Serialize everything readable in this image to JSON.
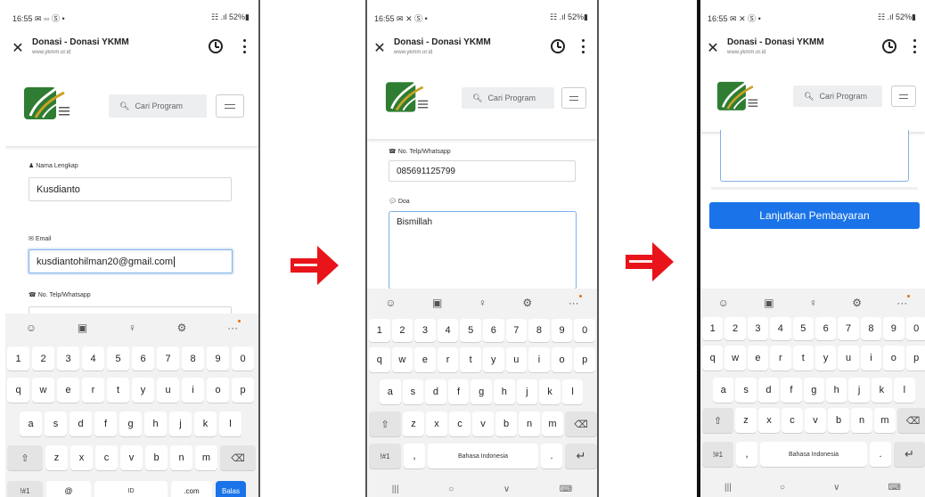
{
  "browser": {
    "title": "Donasi - Donasi YKMM",
    "url": "www.ykmm.or.id"
  },
  "site": {
    "search_label": "Cari Program"
  },
  "screens": [
    {
      "status_time": "16:55",
      "status_icons_left": "✉ ▫▫ Ⓢ •",
      "status_icons_right": "☷ .ıl 52%▮",
      "form": {
        "name_label": "Nama Lengkap",
        "name_value": "Kusdianto",
        "email_label": "Email",
        "email_value": "kusdiantohilman20@gmail.com",
        "phone_label": "No. Telp/Whatsapp"
      },
      "keyboard": {
        "bottom_keys": [
          "!#1",
          "@",
          "ID",
          ".com",
          "Balas"
        ]
      }
    },
    {
      "status_time": "16:55",
      "status_icons_left": "✉ ✕ Ⓢ •",
      "status_icons_right": "☷ .ıl 52%▮",
      "form": {
        "phone_label": "No. Telp/Whatsapp",
        "phone_value": "085691125799",
        "doa_label": "Doa",
        "doa_value": "Bismillah"
      }
    },
    {
      "status_time": "16:55",
      "status_icons_left": "✉ ✕ Ⓢ •",
      "status_icons_right": "☷ .ıl 52%▮",
      "form": {
        "submit_label": "Lanjutkan Pembayaran"
      }
    }
  ],
  "keyboard": {
    "toolbar_icons": [
      "☺",
      "▣",
      "♀",
      "⚙",
      "···"
    ],
    "numbers": [
      "1",
      "2",
      "3",
      "4",
      "5",
      "6",
      "7",
      "8",
      "9",
      "0"
    ],
    "row1": [
      "q",
      "w",
      "e",
      "r",
      "t",
      "y",
      "u",
      "i",
      "o",
      "p"
    ],
    "row2": [
      "a",
      "s",
      "d",
      "f",
      "g",
      "h",
      "j",
      "k",
      "l"
    ],
    "row3": [
      "z",
      "x",
      "c",
      "v",
      "b",
      "n",
      "m"
    ],
    "shift_icon": "⇧",
    "backspace_icon": "⌫",
    "symbols_key": "!#1",
    "comma_key": ",",
    "space_label": "Bahasa Indonesia",
    "period_key": ".",
    "enter_icon": "↵",
    "nav_icons": [
      "|||",
      "○",
      "∨",
      "⌨"
    ]
  },
  "colors": {
    "primary": "#1a73e8",
    "arrow": "#e8141a",
    "focus_border": "#7fb0e6",
    "logo_green": "#2e7d32",
    "logo_gold": "#c9a227"
  }
}
